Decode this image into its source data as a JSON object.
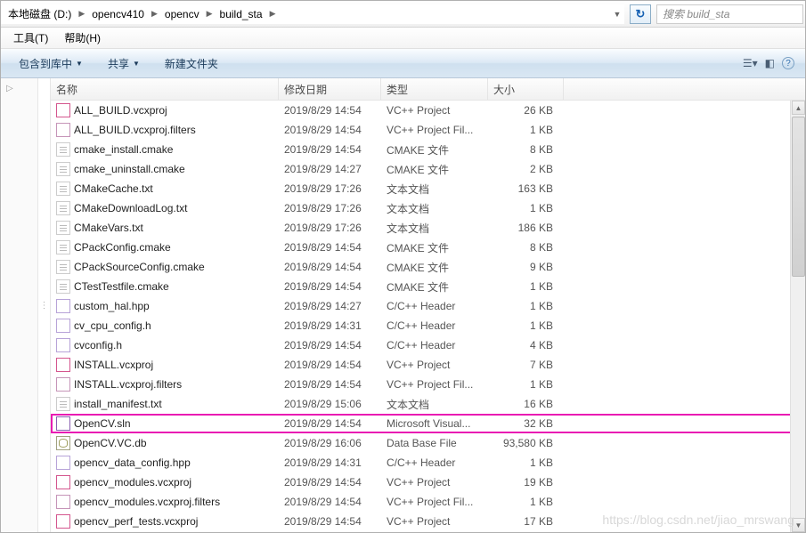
{
  "breadcrumb": {
    "items": [
      "本地磁盘 (D:)",
      "opencv410",
      "opencv",
      "build_sta"
    ]
  },
  "search": {
    "placeholder": "搜索 build_sta"
  },
  "menu": {
    "tools": "工具(T)",
    "help": "帮助(H)"
  },
  "toolbar": {
    "include": "包含到库中",
    "share": "共享",
    "newfolder": "新建文件夹"
  },
  "columns": {
    "name": "名称",
    "date": "修改日期",
    "type": "类型",
    "size": "大小"
  },
  "files": [
    {
      "icon": "i-vcx",
      "name": "ALL_BUILD.vcxproj",
      "date": "2019/8/29 14:54",
      "type": "VC++ Project",
      "size": "26 KB",
      "hl": false
    },
    {
      "icon": "i-vcxf",
      "name": "ALL_BUILD.vcxproj.filters",
      "date": "2019/8/29 14:54",
      "type": "VC++ Project Fil...",
      "size": "1 KB",
      "hl": false
    },
    {
      "icon": "i-txt",
      "name": "cmake_install.cmake",
      "date": "2019/8/29 14:54",
      "type": "CMAKE 文件",
      "size": "8 KB",
      "hl": false
    },
    {
      "icon": "i-txt",
      "name": "cmake_uninstall.cmake",
      "date": "2019/8/29 14:27",
      "type": "CMAKE 文件",
      "size": "2 KB",
      "hl": false
    },
    {
      "icon": "i-txt",
      "name": "CMakeCache.txt",
      "date": "2019/8/29 17:26",
      "type": "文本文档",
      "size": "163 KB",
      "hl": false
    },
    {
      "icon": "i-txt",
      "name": "CMakeDownloadLog.txt",
      "date": "2019/8/29 17:26",
      "type": "文本文档",
      "size": "1 KB",
      "hl": false
    },
    {
      "icon": "i-txt",
      "name": "CMakeVars.txt",
      "date": "2019/8/29 17:26",
      "type": "文本文档",
      "size": "186 KB",
      "hl": false
    },
    {
      "icon": "i-txt",
      "name": "CPackConfig.cmake",
      "date": "2019/8/29 14:54",
      "type": "CMAKE 文件",
      "size": "8 KB",
      "hl": false
    },
    {
      "icon": "i-txt",
      "name": "CPackSourceConfig.cmake",
      "date": "2019/8/29 14:54",
      "type": "CMAKE 文件",
      "size": "9 KB",
      "hl": false
    },
    {
      "icon": "i-txt",
      "name": "CTestTestfile.cmake",
      "date": "2019/8/29 14:54",
      "type": "CMAKE 文件",
      "size": "1 KB",
      "hl": false
    },
    {
      "icon": "i-hdr",
      "name": "custom_hal.hpp",
      "date": "2019/8/29 14:27",
      "type": "C/C++ Header",
      "size": "1 KB",
      "hl": false
    },
    {
      "icon": "i-hdr",
      "name": "cv_cpu_config.h",
      "date": "2019/8/29 14:31",
      "type": "C/C++ Header",
      "size": "1 KB",
      "hl": false
    },
    {
      "icon": "i-hdr",
      "name": "cvconfig.h",
      "date": "2019/8/29 14:54",
      "type": "C/C++ Header",
      "size": "4 KB",
      "hl": false
    },
    {
      "icon": "i-vcx",
      "name": "INSTALL.vcxproj",
      "date": "2019/8/29 14:54",
      "type": "VC++ Project",
      "size": "7 KB",
      "hl": false
    },
    {
      "icon": "i-vcxf",
      "name": "INSTALL.vcxproj.filters",
      "date": "2019/8/29 14:54",
      "type": "VC++ Project Fil...",
      "size": "1 KB",
      "hl": false
    },
    {
      "icon": "i-txt",
      "name": "install_manifest.txt",
      "date": "2019/8/29 15:06",
      "type": "文本文档",
      "size": "16 KB",
      "hl": false
    },
    {
      "icon": "i-sln",
      "name": "OpenCV.sln",
      "date": "2019/8/29 14:54",
      "type": "Microsoft Visual...",
      "size": "32 KB",
      "hl": true
    },
    {
      "icon": "i-db",
      "name": "OpenCV.VC.db",
      "date": "2019/8/29 16:06",
      "type": "Data Base File",
      "size": "93,580 KB",
      "hl": false
    },
    {
      "icon": "i-hdr",
      "name": "opencv_data_config.hpp",
      "date": "2019/8/29 14:31",
      "type": "C/C++ Header",
      "size": "1 KB",
      "hl": false
    },
    {
      "icon": "i-vcx",
      "name": "opencv_modules.vcxproj",
      "date": "2019/8/29 14:54",
      "type": "VC++ Project",
      "size": "19 KB",
      "hl": false
    },
    {
      "icon": "i-vcxf",
      "name": "opencv_modules.vcxproj.filters",
      "date": "2019/8/29 14:54",
      "type": "VC++ Project Fil...",
      "size": "1 KB",
      "hl": false
    },
    {
      "icon": "i-vcx",
      "name": "opencv_perf_tests.vcxproj",
      "date": "2019/8/29 14:54",
      "type": "VC++ Project",
      "size": "17 KB",
      "hl": false
    }
  ],
  "watermark": "https://blog.csdn.net/jiao_mrswang"
}
